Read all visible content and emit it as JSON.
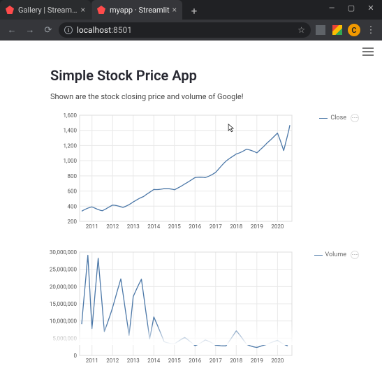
{
  "browser": {
    "tabs": [
      {
        "title": "Gallery | Streamlit — The fastest"
      },
      {
        "title": "myapp · Streamlit"
      }
    ],
    "url_host": "localhost",
    "url_port": ":8501",
    "avatar_letter": "C",
    "window_minimize": "—",
    "window_maximize": "▢",
    "window_close": "✕",
    "new_tab": "+",
    "nav_back": "←",
    "nav_forward": "→",
    "nav_reload": "⟳",
    "star": "☆",
    "kebab": "⋮"
  },
  "page": {
    "title": "Simple Stock Price App",
    "subtitle": "Shown are the stock closing price and volume of Google!"
  },
  "chart1": {
    "legend_label": "Close",
    "x_ticks": [
      "2011",
      "2012",
      "2013",
      "2014",
      "2015",
      "2016",
      "2017",
      "2018",
      "2019",
      "2020"
    ],
    "y_ticks": [
      "200",
      "400",
      "600",
      "800",
      "1,000",
      "1,200",
      "1,400",
      "1,600"
    ]
  },
  "chart2": {
    "legend_label": "Volume",
    "x_ticks": [
      "2011",
      "2012",
      "2013",
      "2014",
      "2015",
      "2016",
      "2017",
      "2018",
      "2019",
      "2020"
    ],
    "y_ticks": [
      "0",
      "5,000,000",
      "10,000,000",
      "15,000,000",
      "20,000,000",
      "25,000,000",
      "30,000,000"
    ]
  },
  "chart_data": [
    {
      "type": "line",
      "title": "",
      "xlabel": "",
      "ylabel": "",
      "ylim": [
        100,
        1600
      ],
      "legend": [
        "Close"
      ],
      "series": [
        {
          "name": "Close",
          "x": [
            2010.5,
            2011,
            2011.5,
            2012,
            2012.5,
            2013,
            2013.5,
            2014,
            2014.5,
            2015,
            2015.5,
            2016,
            2016.5,
            2017,
            2017.5,
            2018,
            2018.5,
            2019,
            2019.5,
            2020,
            2020.3,
            2020.6
          ],
          "y": [
            240,
            300,
            260,
            320,
            300,
            380,
            440,
            560,
            560,
            540,
            640,
            710,
            720,
            800,
            940,
            1060,
            1120,
            1060,
            1220,
            1340,
            1100,
            1460
          ]
        }
      ]
    },
    {
      "type": "line",
      "title": "",
      "xlabel": "",
      "ylabel": "",
      "ylim": [
        0,
        30000000
      ],
      "legend": [
        "Volume"
      ],
      "series": [
        {
          "name": "Volume",
          "x": [
            2010.5,
            2010.8,
            2011,
            2011.3,
            2011.6,
            2012,
            2012.4,
            2012.8,
            2013,
            2013.4,
            2013.8,
            2014,
            2014.5,
            2015,
            2015.5,
            2016,
            2016.5,
            2017,
            2017.5,
            2018,
            2018.5,
            2019,
            2019.5,
            2020,
            2020.5
          ],
          "y": [
            9000000,
            29000000,
            8000000,
            28000000,
            7000000,
            14000000,
            22000000,
            6000000,
            17000000,
            22000000,
            5000000,
            11000000,
            4000000,
            3500000,
            5000000,
            3000000,
            4500000,
            2800000,
            3000000,
            7000000,
            3200000,
            2500000,
            3000000,
            4500000,
            2800000
          ]
        }
      ]
    }
  ]
}
